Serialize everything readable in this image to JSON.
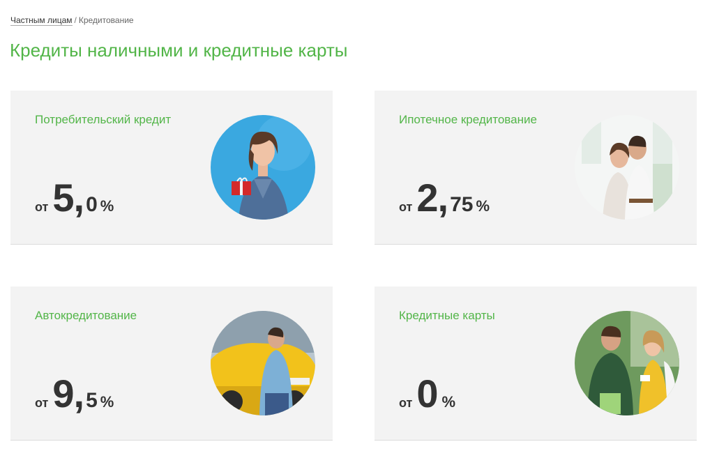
{
  "breadcrumb": {
    "parent": "Частным лицам",
    "separator": "/",
    "current": "Кредитование"
  },
  "page_title": "Кредиты наличными и кредитные карты",
  "colors": {
    "accent": "#52b548",
    "card_bg": "#f3f3f3",
    "rate_text": "#333333"
  },
  "cards": [
    {
      "title": "Потребительский кредит",
      "from": "от",
      "rate_int": "5",
      "rate_comma": ",",
      "rate_frac": "0",
      "pct": "%",
      "image": "woman-with-gift-photo"
    },
    {
      "title": "Ипотечное кредитование",
      "from": "от",
      "rate_int": "2",
      "rate_comma": ",",
      "rate_frac": "75",
      "pct": "%",
      "image": "couple-in-home-photo"
    },
    {
      "title": "Автокредитование",
      "from": "от",
      "rate_int": "9",
      "rate_comma": ",",
      "rate_frac": "5",
      "pct": "%",
      "image": "man-with-yellow-car-photo"
    },
    {
      "title": "Кредитные карты",
      "from": "от",
      "rate_int": "0",
      "rate_comma": "",
      "rate_frac": "",
      "pct": "%",
      "image": "couple-shopping-photo"
    }
  ]
}
